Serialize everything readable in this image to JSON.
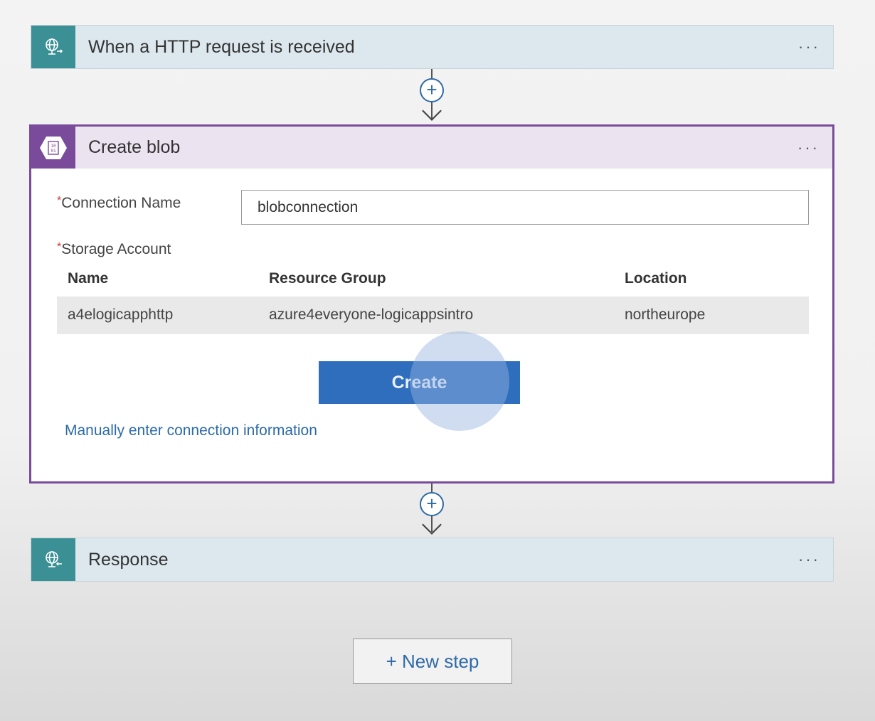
{
  "steps": [
    {
      "title": "When a HTTP request is received",
      "icon": "http-globe-icon",
      "color": "#3b9096"
    },
    {
      "title": "Create blob",
      "icon": "blob-storage-icon",
      "color": "#7a4b9b"
    },
    {
      "title": "Response",
      "icon": "http-globe-icon",
      "color": "#3b9096"
    }
  ],
  "more_label": "···",
  "blob_form": {
    "connection_name_label": "Connection Name",
    "connection_name_value": "blobconnection",
    "storage_account_label": "Storage Account",
    "required_mark": "*",
    "columns": [
      "Name",
      "Resource Group",
      "Location"
    ],
    "rows": [
      [
        "a4elogicapphttp",
        "azure4everyone-logicappsintro",
        "northeurope"
      ]
    ],
    "create_label": "Create",
    "manual_link": "Manually enter connection information"
  },
  "add_label": "+",
  "new_step_label": "+ New step"
}
